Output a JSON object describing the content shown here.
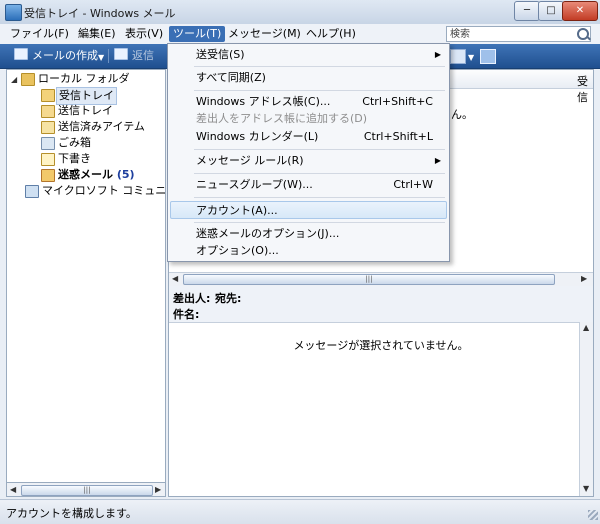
{
  "window": {
    "title": "受信トレイ - Windows メール",
    "minimize_label": "─",
    "maximize_label": "□",
    "close_label": "✕"
  },
  "menubar": {
    "items": [
      {
        "label": "ファイル(F)"
      },
      {
        "label": "編集(E)"
      },
      {
        "label": "表示(V)"
      },
      {
        "label": "ツール(T)"
      },
      {
        "label": "メッセージ(M)"
      },
      {
        "label": "ヘルプ(H)"
      }
    ],
    "active_index": 3,
    "search_placeholder": "検索"
  },
  "toolbar": {
    "compose_label": "メールの作成",
    "reply_label": "返信"
  },
  "folder_tree": {
    "root_label": "ローカル フォルダ",
    "folders": [
      {
        "label": "受信トレイ",
        "icon": "inbox-icon"
      },
      {
        "label": "送信トレイ",
        "icon": "outbox-icon"
      },
      {
        "label": "送信済みアイテム",
        "icon": "sent-items-icon"
      },
      {
        "label": "ごみ箱",
        "icon": "trash-icon"
      },
      {
        "label": "下書き",
        "icon": "drafts-icon"
      },
      {
        "label": "迷惑メール",
        "count": "(5)",
        "icon": "junk-icon"
      }
    ],
    "community_label": "マイクロソフト コミュニティ"
  },
  "message_list": {
    "column_header": "受信",
    "partial_text": "ん。"
  },
  "preview": {
    "from_label": "差出人:",
    "to_label": "宛先:",
    "subject_label": "件名:",
    "empty_message": "メッセージが選択されていません。"
  },
  "tools_menu": {
    "items": [
      {
        "label": "送受信(S)",
        "submenu": true
      },
      {
        "label": "すべて同期(Z)"
      },
      {
        "label": "Windows アドレス帳(C)...",
        "shortcut": "Ctrl+Shift+C"
      },
      {
        "label": "差出人をアドレス帳に追加する(D)",
        "disabled": true
      },
      {
        "label": "Windows カレンダー(L)",
        "shortcut": "Ctrl+Shift+L"
      },
      {
        "label": "メッセージ ルール(R)",
        "submenu": true
      },
      {
        "label": "ニュースグループ(W)...",
        "shortcut": "Ctrl+W"
      },
      {
        "label": "アカウント(A)...",
        "highlighted": true
      },
      {
        "label": "迷惑メールのオプション(J)..."
      },
      {
        "label": "オプション(O)..."
      }
    ],
    "submenu_arrow": "▶"
  },
  "statusbar": {
    "text": "アカウントを構成します。"
  },
  "colors": {
    "toolbar_blue": "#2c5c9f",
    "menu_highlight": "#3a6fb5",
    "junk_count": "#1e3f9e"
  }
}
